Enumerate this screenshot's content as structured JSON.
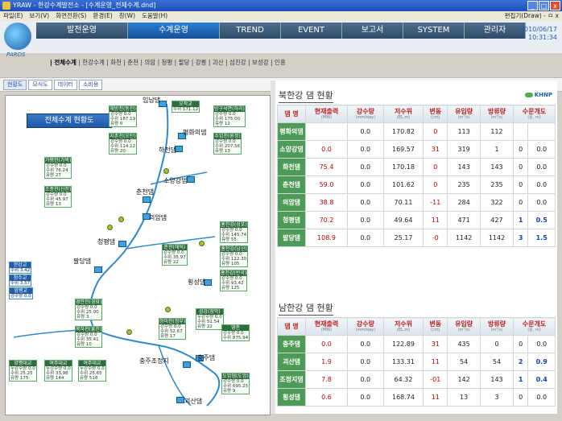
{
  "window": {
    "title": "YRAW - 한강수계발전소 - [수계운영_전체수계.dnd]",
    "controls": [
      "_",
      "□",
      "x"
    ]
  },
  "menu": {
    "items": [
      "파일(E)",
      "보기(V)",
      "화면전환(S)",
      "환경(E)",
      "창(W)",
      "도움말(H)"
    ],
    "right": "편집기(Draw) - ㅁ x"
  },
  "brand": {
    "name": "PAROS"
  },
  "tabs": [
    "발전운영",
    "수계운영",
    "TREND",
    "EVENT",
    "보고서",
    "SYSTEM",
    "관리자"
  ],
  "active_tab": "수계운영",
  "datetime": {
    "date": "2010/06/17",
    "time": "10:31:34"
  },
  "subnav": {
    "active": "전체수계",
    "items": [
      "한강수계",
      "화천",
      "춘천",
      "의암",
      "청평",
      "팔당",
      "강릉",
      "괴산",
      "섬진강",
      "보성강",
      "인흥"
    ]
  },
  "subtabs": [
    "현황도",
    "모식도",
    "데이터",
    "소비용"
  ],
  "map": {
    "title": "전체수계 현황도",
    "dams": [
      "임남댐",
      "평화의댐",
      "하천댐",
      "소양강댐",
      "춘천댐",
      "의암댐",
      "청평댐",
      "팔당댐",
      "횡성댐",
      "충주조정지",
      "충주댐",
      "괴산댐"
    ],
    "gauges": [
      {
        "name": "해방천(동천)",
        "rows": [
          "강수량 0.0",
          "수위 187.19",
          "유량 0"
        ]
      },
      {
        "name": "오작교",
        "rows": [
          "수위 171.12"
        ]
      },
      {
        "name": "방구석면(하리)",
        "rows": [
          "강수량 0.0",
          "수위 175.00",
          "유량 12"
        ]
      },
      {
        "name": "지촌천(오탄)",
        "rows": [
          "강수량 0.0",
          "수위 114.12",
          "유량 20"
        ]
      },
      {
        "name": "수입천(원정)",
        "rows": [
          "강수량 0.0",
          "수위 207.56",
          "유량 13"
        ]
      },
      {
        "name": "가평천(가목)",
        "rows": [
          "강수량 0.0",
          "수위 76.24",
          "유량 27"
        ]
      },
      {
        "name": "조종천(신천)",
        "rows": [
          "강수량 0.0",
          "수위 45.97",
          "유량 13"
        ]
      },
      {
        "name": "한강교",
        "rows": [
          "수위 3.42"
        ]
      },
      {
        "name": "청수교",
        "rows": [
          "수위 3.57"
        ]
      },
      {
        "name": "양평교",
        "rows": [
          "강수량 0.0"
        ]
      },
      {
        "name": "홍천강(성포)",
        "rows": [
          "강수량 0.0",
          "수위 145.74",
          "유량 55"
        ]
      },
      {
        "name": "홍천강(남산)",
        "rows": [
          "강수량 0.0",
          "수위 122.30",
          "유량 105"
        ]
      },
      {
        "name": "홍천강(반곡)",
        "rows": [
          "강수량 0.0",
          "수위 93.42",
          "유량 125"
        ]
      },
      {
        "name": "춘천(해덕)",
        "rows": [
          "강수량 0.0",
          "수위 35.97",
          "유량 22"
        ]
      },
      {
        "name": "경안천(경화)",
        "rows": [
          "강수량 0.0",
          "수위 25.00",
          "유량 3"
        ]
      },
      {
        "name": "섬강(장막)",
        "rows": [
          "누강수량 0.0",
          "수위 51.54",
          "유량 22"
        ]
      },
      {
        "name": "청미천(청부)",
        "rows": [
          "강수량 0.0",
          "수위 52.67",
          "유량 17"
        ]
      },
      {
        "name": "복하천(흥천)",
        "rows": [
          "강수량 0.0",
          "수위 35.41",
          "유량 10"
        ]
      },
      {
        "name": "영춘",
        "rows": [
          "강수량 0.0",
          "수위 875.94"
        ]
      },
      {
        "name": "양평대교",
        "rows": [
          "누강수량 0.0",
          "수위 25.25",
          "유량 175"
        ]
      },
      {
        "name": "여주대교",
        "rows": [
          "누강수량 0.0",
          "수위 33.98",
          "유량 144"
        ]
      },
      {
        "name": "여주대교",
        "rows": [
          "누강수량 0.0",
          "수위 25.65",
          "유량 518"
        ]
      },
      {
        "name": "도암댐(도암)",
        "rows": [
          "강수량 0.0",
          "수위 695.25",
          "유량 9"
        ]
      }
    ]
  },
  "logo_right": "KHNP",
  "north": {
    "title": "북한강 댐 현황",
    "headers": [
      {
        "label": "댐 명",
        "unit": ""
      },
      {
        "label": "현재출력",
        "unit": "(MW)"
      },
      {
        "label": "강수량",
        "unit": "(mm/day)"
      },
      {
        "label": "저수위",
        "unit": "(EL.m)"
      },
      {
        "label": "변동",
        "unit": "(cm)"
      },
      {
        "label": "유입량",
        "unit": "(m³/s)"
      },
      {
        "label": "방류량",
        "unit": "(m³/s)"
      },
      {
        "label": "수문개도",
        "unit": "(문, m)"
      }
    ],
    "rows": [
      [
        "평화의댐",
        "",
        "0.0",
        "170.82",
        "0",
        "113",
        "112",
        "",
        ""
      ],
      [
        "소양강댐",
        "0.0",
        "0.0",
        "169.57",
        "31",
        "319",
        "1",
        "0",
        "0.0"
      ],
      [
        "화천댐",
        "75.4",
        "0.0",
        "170.18",
        "0",
        "143",
        "143",
        "0",
        "0.0"
      ],
      [
        "춘천댐",
        "59.0",
        "0.0",
        "101.62",
        "0",
        "235",
        "235",
        "0",
        "0.0"
      ],
      [
        "의암댐",
        "38.8",
        "0.0",
        "70.11",
        "-11",
        "284",
        "322",
        "0",
        "0.0"
      ],
      [
        "청평댐",
        "70.2",
        "0.0",
        "49.64",
        "11",
        "471",
        "427",
        "1",
        "0.5"
      ],
      [
        "팔당댐",
        "108.9",
        "0.0",
        "25.17",
        "-0",
        "1142",
        "1142",
        "3",
        "1.5"
      ]
    ]
  },
  "south": {
    "title": "남한강 댐 현황",
    "rows": [
      [
        "충주댐",
        "0.0",
        "0.0",
        "122.89",
        "31",
        "435",
        "0",
        "0",
        "0.0"
      ],
      [
        "괴산댐",
        "1.9",
        "0.0",
        "133.31",
        "11",
        "54",
        "54",
        "2",
        "0.9"
      ],
      [
        "조정지댐",
        "7.8",
        "0.0",
        "64.32",
        "-01",
        "142",
        "143",
        "1",
        "0.4"
      ],
      [
        "횡성댐",
        "0.6",
        "0.0",
        "168.74",
        "11",
        "13",
        "3",
        "0",
        "0.0"
      ]
    ]
  },
  "colors": {
    "accent": "#1d5fa8",
    "dam_header": "#4d9b56",
    "warn_red": "#c00000"
  }
}
